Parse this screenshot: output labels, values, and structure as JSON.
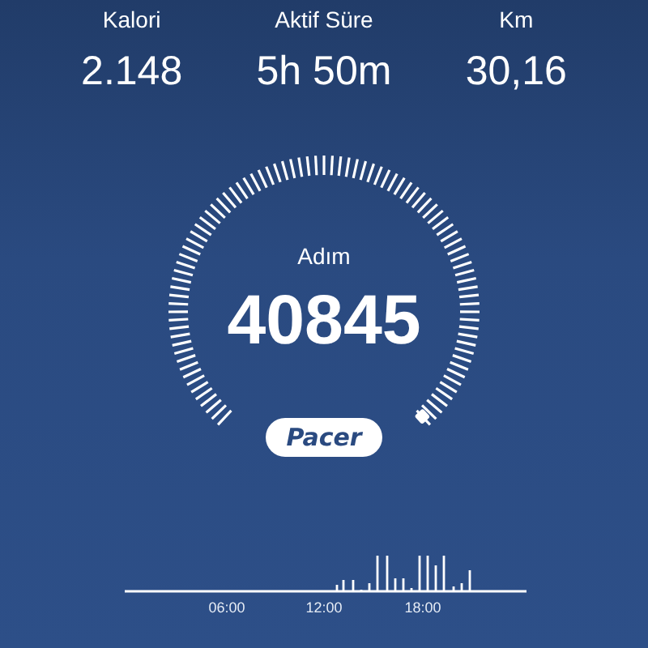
{
  "stats": [
    {
      "label": "Kalori",
      "value": "2.148"
    },
    {
      "label": "Aktif Süre",
      "value": "5h 50m"
    },
    {
      "label": "Km",
      "value": "30,16"
    }
  ],
  "gauge": {
    "label": "Adım",
    "value": "40845"
  },
  "badge": "Pacer",
  "activity": {
    "time_labels": [
      "06:00",
      "12:00",
      "18:00"
    ]
  }
}
